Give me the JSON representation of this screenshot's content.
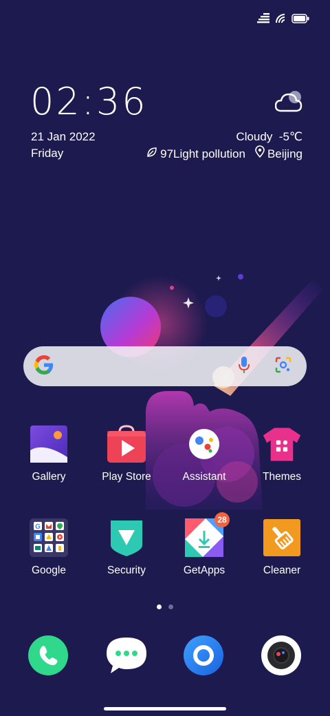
{
  "status_bar": {
    "icons": [
      "data-icon",
      "wifi-icon",
      "battery-icon"
    ]
  },
  "clock": {
    "time": "02:36",
    "date": "21 Jan 2022",
    "day": "Friday"
  },
  "weather": {
    "icon": "cloud-icon",
    "condition_temp": "Cloudy  -5℃",
    "air_value": "97Light pollution",
    "location": "Beijing"
  },
  "search": {
    "provider": "Google",
    "mic_icon": "mic-icon",
    "lens_icon": "lens-icon"
  },
  "apps_row1": [
    {
      "label": "Gallery"
    },
    {
      "label": "Play Store"
    },
    {
      "label": "Assistant"
    },
    {
      "label": "Themes"
    }
  ],
  "apps_row2": [
    {
      "label": "Google"
    },
    {
      "label": "Security"
    },
    {
      "label": "GetApps",
      "badge": "28"
    },
    {
      "label": "Cleaner"
    }
  ],
  "dock": [
    {
      "name": "Phone"
    },
    {
      "name": "Messages"
    },
    {
      "name": "Browser"
    },
    {
      "name": "Camera"
    }
  ],
  "page_indicator": {
    "pages": 2,
    "active": 1
  },
  "colors": {
    "background": "#1d1a4f",
    "accent_pink": "#e53a8a",
    "badge": "#f1643f"
  }
}
